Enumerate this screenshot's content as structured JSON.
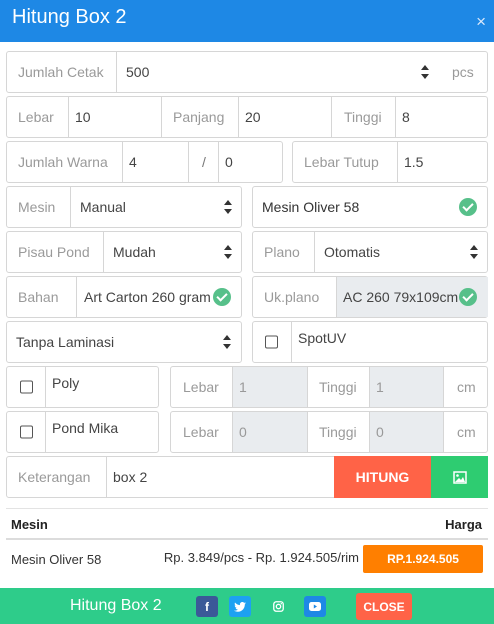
{
  "modal": {
    "title": "Hitung Box 2",
    "close_symbol": "×"
  },
  "form": {
    "jumlah_cetak": {
      "label": "Jumlah Cetak",
      "value": "500",
      "unit": "pcs"
    },
    "lebar": {
      "label": "Lebar",
      "value": "10"
    },
    "panjang": {
      "label": "Panjang",
      "value": "20"
    },
    "tinggi": {
      "label": "Tinggi",
      "value": "8"
    },
    "jumlah_warna": {
      "label": "Jumlah Warna",
      "value1": "4",
      "separator": "/",
      "value2": "0"
    },
    "lebar_tutup": {
      "label": "Lebar Tutup",
      "value": "1.5"
    },
    "mesin": {
      "label": "Mesin",
      "value": "Manual",
      "machine": "Mesin Oliver 58"
    },
    "pisau_pond": {
      "label": "Pisau Pond",
      "value": "Mudah"
    },
    "plano": {
      "label": "Plano",
      "value": "Otomatis"
    },
    "bahan": {
      "label": "Bahan",
      "value": "Art Carton 260 gram"
    },
    "uk_plano": {
      "label": "Uk.plano",
      "value": "AC 260 79x109cm"
    },
    "laminasi": {
      "value": "Tanpa Laminasi"
    },
    "spotuv": {
      "label": "SpotUV",
      "checked": false
    },
    "poly": {
      "label": "Poly",
      "lebar_label": "Lebar",
      "lebar_value": "1",
      "tinggi_label": "Tinggi",
      "tinggi_value": "1",
      "unit": "cm"
    },
    "pond_mika": {
      "label": "Pond Mika",
      "lebar_label": "Lebar",
      "lebar_value": "0",
      "tinggi_label": "Tinggi",
      "tinggi_value": "0",
      "unit": "cm"
    },
    "keterangan": {
      "label": "Keterangan",
      "value": "box 2"
    },
    "hitung_label": "HITUNG",
    "image_icon": "image-icon"
  },
  "results": {
    "headers": {
      "mesin": "Mesin",
      "harga": "Harga"
    },
    "rows": [
      {
        "mesin": "Mesin Oliver 58",
        "detail": "Rp. 3.849/pcs - Rp. 1.924.505/rim",
        "price": "RP.1.924.505"
      }
    ]
  },
  "footer": {
    "title": "Hitung Box 2",
    "social": [
      "facebook-icon",
      "twitter-icon",
      "instagram-icon",
      "youtube-icon"
    ],
    "close_label": "CLOSE"
  },
  "colors": {
    "header": "#1e88e5",
    "footer": "#2ecc8a",
    "hitung": "#ff6347",
    "image_btn": "#2ecc71",
    "price_btn": "#ff7f00",
    "close_btn": "#ff6347"
  }
}
